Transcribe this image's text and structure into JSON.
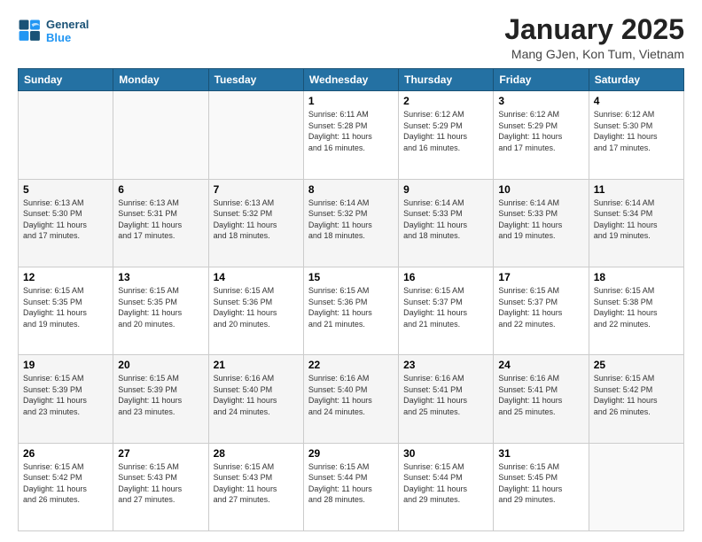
{
  "header": {
    "logo_line1": "General",
    "logo_line2": "Blue",
    "month": "January 2025",
    "location": "Mang GJen, Kon Tum, Vietnam"
  },
  "weekdays": [
    "Sunday",
    "Monday",
    "Tuesday",
    "Wednesday",
    "Thursday",
    "Friday",
    "Saturday"
  ],
  "weeks": [
    [
      {
        "day": "",
        "info": ""
      },
      {
        "day": "",
        "info": ""
      },
      {
        "day": "",
        "info": ""
      },
      {
        "day": "1",
        "info": "Sunrise: 6:11 AM\nSunset: 5:28 PM\nDaylight: 11 hours\nand 16 minutes."
      },
      {
        "day": "2",
        "info": "Sunrise: 6:12 AM\nSunset: 5:29 PM\nDaylight: 11 hours\nand 16 minutes."
      },
      {
        "day": "3",
        "info": "Sunrise: 6:12 AM\nSunset: 5:29 PM\nDaylight: 11 hours\nand 17 minutes."
      },
      {
        "day": "4",
        "info": "Sunrise: 6:12 AM\nSunset: 5:30 PM\nDaylight: 11 hours\nand 17 minutes."
      }
    ],
    [
      {
        "day": "5",
        "info": "Sunrise: 6:13 AM\nSunset: 5:30 PM\nDaylight: 11 hours\nand 17 minutes."
      },
      {
        "day": "6",
        "info": "Sunrise: 6:13 AM\nSunset: 5:31 PM\nDaylight: 11 hours\nand 17 minutes."
      },
      {
        "day": "7",
        "info": "Sunrise: 6:13 AM\nSunset: 5:32 PM\nDaylight: 11 hours\nand 18 minutes."
      },
      {
        "day": "8",
        "info": "Sunrise: 6:14 AM\nSunset: 5:32 PM\nDaylight: 11 hours\nand 18 minutes."
      },
      {
        "day": "9",
        "info": "Sunrise: 6:14 AM\nSunset: 5:33 PM\nDaylight: 11 hours\nand 18 minutes."
      },
      {
        "day": "10",
        "info": "Sunrise: 6:14 AM\nSunset: 5:33 PM\nDaylight: 11 hours\nand 19 minutes."
      },
      {
        "day": "11",
        "info": "Sunrise: 6:14 AM\nSunset: 5:34 PM\nDaylight: 11 hours\nand 19 minutes."
      }
    ],
    [
      {
        "day": "12",
        "info": "Sunrise: 6:15 AM\nSunset: 5:35 PM\nDaylight: 11 hours\nand 19 minutes."
      },
      {
        "day": "13",
        "info": "Sunrise: 6:15 AM\nSunset: 5:35 PM\nDaylight: 11 hours\nand 20 minutes."
      },
      {
        "day": "14",
        "info": "Sunrise: 6:15 AM\nSunset: 5:36 PM\nDaylight: 11 hours\nand 20 minutes."
      },
      {
        "day": "15",
        "info": "Sunrise: 6:15 AM\nSunset: 5:36 PM\nDaylight: 11 hours\nand 21 minutes."
      },
      {
        "day": "16",
        "info": "Sunrise: 6:15 AM\nSunset: 5:37 PM\nDaylight: 11 hours\nand 21 minutes."
      },
      {
        "day": "17",
        "info": "Sunrise: 6:15 AM\nSunset: 5:37 PM\nDaylight: 11 hours\nand 22 minutes."
      },
      {
        "day": "18",
        "info": "Sunrise: 6:15 AM\nSunset: 5:38 PM\nDaylight: 11 hours\nand 22 minutes."
      }
    ],
    [
      {
        "day": "19",
        "info": "Sunrise: 6:15 AM\nSunset: 5:39 PM\nDaylight: 11 hours\nand 23 minutes."
      },
      {
        "day": "20",
        "info": "Sunrise: 6:15 AM\nSunset: 5:39 PM\nDaylight: 11 hours\nand 23 minutes."
      },
      {
        "day": "21",
        "info": "Sunrise: 6:16 AM\nSunset: 5:40 PM\nDaylight: 11 hours\nand 24 minutes."
      },
      {
        "day": "22",
        "info": "Sunrise: 6:16 AM\nSunset: 5:40 PM\nDaylight: 11 hours\nand 24 minutes."
      },
      {
        "day": "23",
        "info": "Sunrise: 6:16 AM\nSunset: 5:41 PM\nDaylight: 11 hours\nand 25 minutes."
      },
      {
        "day": "24",
        "info": "Sunrise: 6:16 AM\nSunset: 5:41 PM\nDaylight: 11 hours\nand 25 minutes."
      },
      {
        "day": "25",
        "info": "Sunrise: 6:15 AM\nSunset: 5:42 PM\nDaylight: 11 hours\nand 26 minutes."
      }
    ],
    [
      {
        "day": "26",
        "info": "Sunrise: 6:15 AM\nSunset: 5:42 PM\nDaylight: 11 hours\nand 26 minutes."
      },
      {
        "day": "27",
        "info": "Sunrise: 6:15 AM\nSunset: 5:43 PM\nDaylight: 11 hours\nand 27 minutes."
      },
      {
        "day": "28",
        "info": "Sunrise: 6:15 AM\nSunset: 5:43 PM\nDaylight: 11 hours\nand 27 minutes."
      },
      {
        "day": "29",
        "info": "Sunrise: 6:15 AM\nSunset: 5:44 PM\nDaylight: 11 hours\nand 28 minutes."
      },
      {
        "day": "30",
        "info": "Sunrise: 6:15 AM\nSunset: 5:44 PM\nDaylight: 11 hours\nand 29 minutes."
      },
      {
        "day": "31",
        "info": "Sunrise: 6:15 AM\nSunset: 5:45 PM\nDaylight: 11 hours\nand 29 minutes."
      },
      {
        "day": "",
        "info": ""
      }
    ]
  ]
}
